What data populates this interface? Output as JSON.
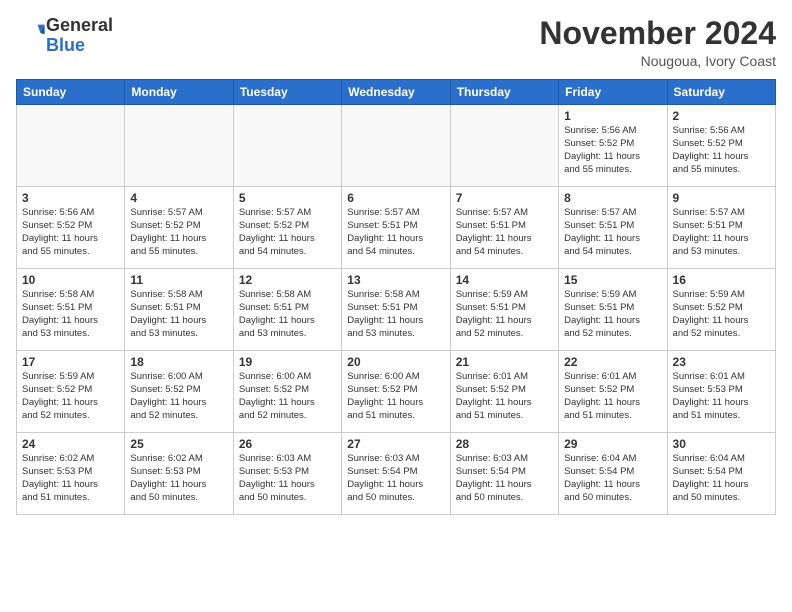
{
  "header": {
    "logo_general": "General",
    "logo_blue": "Blue",
    "month": "November 2024",
    "location": "Nougoua, Ivory Coast"
  },
  "calendar": {
    "weekdays": [
      "Sunday",
      "Monday",
      "Tuesday",
      "Wednesday",
      "Thursday",
      "Friday",
      "Saturday"
    ],
    "weeks": [
      [
        {
          "day": "",
          "info": ""
        },
        {
          "day": "",
          "info": ""
        },
        {
          "day": "",
          "info": ""
        },
        {
          "day": "",
          "info": ""
        },
        {
          "day": "",
          "info": ""
        },
        {
          "day": "1",
          "info": "Sunrise: 5:56 AM\nSunset: 5:52 PM\nDaylight: 11 hours\nand 55 minutes."
        },
        {
          "day": "2",
          "info": "Sunrise: 5:56 AM\nSunset: 5:52 PM\nDaylight: 11 hours\nand 55 minutes."
        }
      ],
      [
        {
          "day": "3",
          "info": "Sunrise: 5:56 AM\nSunset: 5:52 PM\nDaylight: 11 hours\nand 55 minutes."
        },
        {
          "day": "4",
          "info": "Sunrise: 5:57 AM\nSunset: 5:52 PM\nDaylight: 11 hours\nand 55 minutes."
        },
        {
          "day": "5",
          "info": "Sunrise: 5:57 AM\nSunset: 5:52 PM\nDaylight: 11 hours\nand 54 minutes."
        },
        {
          "day": "6",
          "info": "Sunrise: 5:57 AM\nSunset: 5:51 PM\nDaylight: 11 hours\nand 54 minutes."
        },
        {
          "day": "7",
          "info": "Sunrise: 5:57 AM\nSunset: 5:51 PM\nDaylight: 11 hours\nand 54 minutes."
        },
        {
          "day": "8",
          "info": "Sunrise: 5:57 AM\nSunset: 5:51 PM\nDaylight: 11 hours\nand 54 minutes."
        },
        {
          "day": "9",
          "info": "Sunrise: 5:57 AM\nSunset: 5:51 PM\nDaylight: 11 hours\nand 53 minutes."
        }
      ],
      [
        {
          "day": "10",
          "info": "Sunrise: 5:58 AM\nSunset: 5:51 PM\nDaylight: 11 hours\nand 53 minutes."
        },
        {
          "day": "11",
          "info": "Sunrise: 5:58 AM\nSunset: 5:51 PM\nDaylight: 11 hours\nand 53 minutes."
        },
        {
          "day": "12",
          "info": "Sunrise: 5:58 AM\nSunset: 5:51 PM\nDaylight: 11 hours\nand 53 minutes."
        },
        {
          "day": "13",
          "info": "Sunrise: 5:58 AM\nSunset: 5:51 PM\nDaylight: 11 hours\nand 53 minutes."
        },
        {
          "day": "14",
          "info": "Sunrise: 5:59 AM\nSunset: 5:51 PM\nDaylight: 11 hours\nand 52 minutes."
        },
        {
          "day": "15",
          "info": "Sunrise: 5:59 AM\nSunset: 5:51 PM\nDaylight: 11 hours\nand 52 minutes."
        },
        {
          "day": "16",
          "info": "Sunrise: 5:59 AM\nSunset: 5:52 PM\nDaylight: 11 hours\nand 52 minutes."
        }
      ],
      [
        {
          "day": "17",
          "info": "Sunrise: 5:59 AM\nSunset: 5:52 PM\nDaylight: 11 hours\nand 52 minutes."
        },
        {
          "day": "18",
          "info": "Sunrise: 6:00 AM\nSunset: 5:52 PM\nDaylight: 11 hours\nand 52 minutes."
        },
        {
          "day": "19",
          "info": "Sunrise: 6:00 AM\nSunset: 5:52 PM\nDaylight: 11 hours\nand 52 minutes."
        },
        {
          "day": "20",
          "info": "Sunrise: 6:00 AM\nSunset: 5:52 PM\nDaylight: 11 hours\nand 51 minutes."
        },
        {
          "day": "21",
          "info": "Sunrise: 6:01 AM\nSunset: 5:52 PM\nDaylight: 11 hours\nand 51 minutes."
        },
        {
          "day": "22",
          "info": "Sunrise: 6:01 AM\nSunset: 5:52 PM\nDaylight: 11 hours\nand 51 minutes."
        },
        {
          "day": "23",
          "info": "Sunrise: 6:01 AM\nSunset: 5:53 PM\nDaylight: 11 hours\nand 51 minutes."
        }
      ],
      [
        {
          "day": "24",
          "info": "Sunrise: 6:02 AM\nSunset: 5:53 PM\nDaylight: 11 hours\nand 51 minutes."
        },
        {
          "day": "25",
          "info": "Sunrise: 6:02 AM\nSunset: 5:53 PM\nDaylight: 11 hours\nand 50 minutes."
        },
        {
          "day": "26",
          "info": "Sunrise: 6:03 AM\nSunset: 5:53 PM\nDaylight: 11 hours\nand 50 minutes."
        },
        {
          "day": "27",
          "info": "Sunrise: 6:03 AM\nSunset: 5:54 PM\nDaylight: 11 hours\nand 50 minutes."
        },
        {
          "day": "28",
          "info": "Sunrise: 6:03 AM\nSunset: 5:54 PM\nDaylight: 11 hours\nand 50 minutes."
        },
        {
          "day": "29",
          "info": "Sunrise: 6:04 AM\nSunset: 5:54 PM\nDaylight: 11 hours\nand 50 minutes."
        },
        {
          "day": "30",
          "info": "Sunrise: 6:04 AM\nSunset: 5:54 PM\nDaylight: 11 hours\nand 50 minutes."
        }
      ]
    ]
  }
}
